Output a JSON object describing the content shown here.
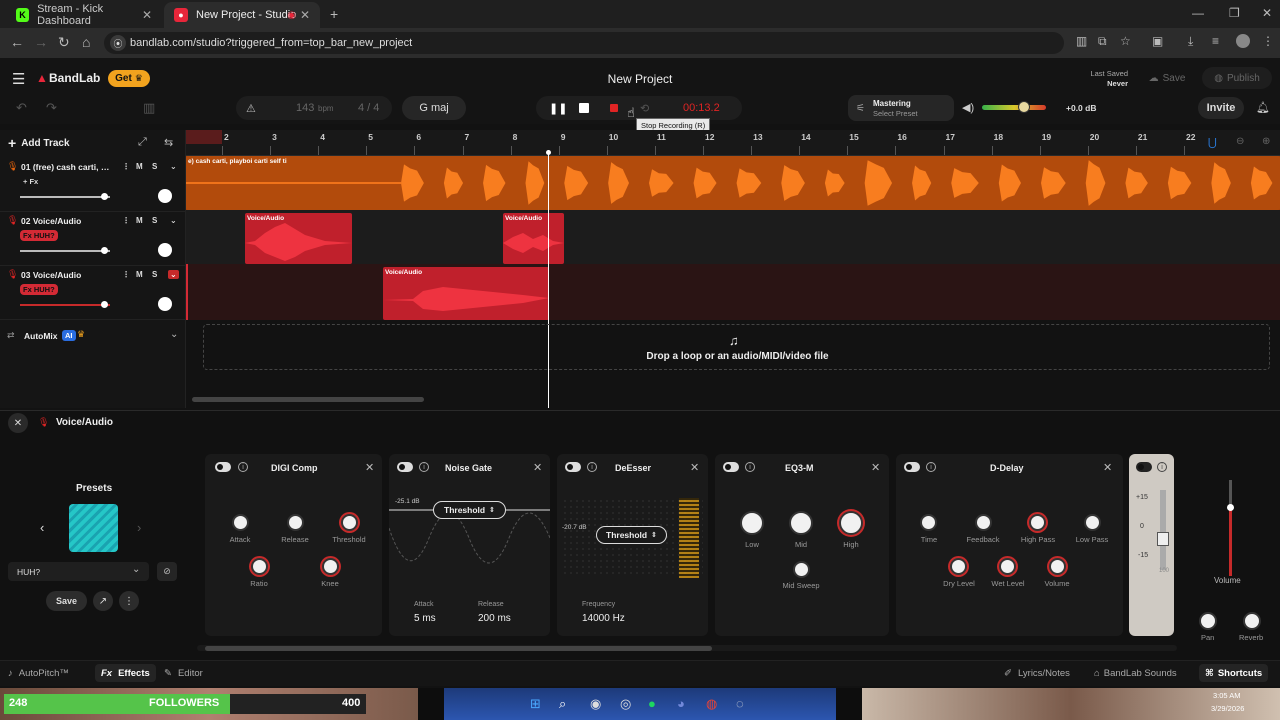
{
  "browser": {
    "tabs": [
      {
        "title": "Stream - Kick Dashboard",
        "favicon": "kick-icon"
      },
      {
        "title": "New Project - Studio",
        "favicon": "bandlab-icon"
      }
    ],
    "url": "bandlab.com/studio?triggered_from=top_bar_new_project"
  },
  "header": {
    "brand": "BandLab",
    "get_label": "Get",
    "project_title": "New Project",
    "last_saved_label": "Last Saved",
    "last_saved_value": "Never",
    "save_label": "Save",
    "publish_label": "Publish"
  },
  "transport": {
    "tempo": "143",
    "tempo_unit": "bpm",
    "time_sig": "4 / 4",
    "key": "G maj",
    "time": "00:13.2",
    "tooltip": "Stop Recording (R)",
    "mastering_title": "Mastering",
    "mastering_preset": "Select Preset",
    "volume_db": "+0.0 dB",
    "invite_label": "Invite"
  },
  "tracks_panel": {
    "add_track": "Add Track",
    "tracks": [
      {
        "name": "01  (free) cash carti, pl...",
        "fx": "+ Fx"
      },
      {
        "name": "02  Voice/Audio",
        "fx": "Fx  HUH?"
      },
      {
        "name": "03  Voice/Audio",
        "fx": "Fx  HUH?"
      }
    ],
    "mute": "M",
    "solo": "S",
    "automix": "AutoMix",
    "ai_badge": "AI"
  },
  "ruler": {
    "bars": [
      "2",
      "3",
      "4",
      "5",
      "6",
      "7",
      "8",
      "9",
      "10",
      "11",
      "12",
      "13",
      "14",
      "15",
      "16",
      "17",
      "18",
      "19",
      "20",
      "21",
      "22"
    ]
  },
  "clips": {
    "track1_label": "e) cash carti, playboi carti self ti",
    "voice_label": "Voice/Audio"
  },
  "dropzone_text": "Drop a loop or an audio/MIDI/video file",
  "fx_panel": {
    "track_label": "Voice/Audio",
    "presets_title": "Presets",
    "preset_name": "HUH?",
    "save_label": "Save",
    "cards": {
      "digicomp": {
        "title": "DIGI Comp",
        "knobs": [
          "Attack",
          "Release",
          "Threshold",
          "Ratio",
          "Knee"
        ]
      },
      "noisegate": {
        "title": "Noise Gate",
        "level": "-25.1 dB",
        "threshold": "Threshold",
        "attack_label": "Attack",
        "attack_value": "5 ms",
        "release_label": "Release",
        "release_value": "200 ms"
      },
      "deesser": {
        "title": "DeEsser",
        "level": "-20.7 dB",
        "threshold": "Threshold",
        "freq_label": "Frequency",
        "freq_value": "14000 Hz"
      },
      "eq": {
        "title": "EQ3-M",
        "knobs": [
          "Low",
          "Mid",
          "High",
          "Mid Sweep"
        ]
      },
      "delay": {
        "title": "D-Delay",
        "knobs": [
          "Time",
          "Feedback",
          "High Pass",
          "Low Pass",
          "Dry Level",
          "Wet Level",
          "Volume"
        ]
      }
    },
    "meter_scale": [
      "+15",
      "0",
      "-15"
    ],
    "meter_extra": "100",
    "volume_label": "Volume",
    "pan_label": "Pan",
    "reverb_label": "Reverb"
  },
  "bottom_bar": {
    "autopitch": "AutoPitch™",
    "effects": "Effects",
    "editor": "Editor",
    "lyrics": "Lyrics/Notes",
    "sounds": "BandLab Sounds",
    "shortcuts": "Shortcuts"
  },
  "overlay": {
    "count": "248",
    "followers": "FOLLOWERS",
    "goal": "400",
    "clock_time": "3:05 AM",
    "clock_date": "3/29/2026"
  },
  "colors": {
    "accent_orange": "#e8650d",
    "record_red": "#c62a2a",
    "clip_red": "#d42a35",
    "preset_teal": "#25c7c7",
    "follower_green": "#55c44a"
  }
}
